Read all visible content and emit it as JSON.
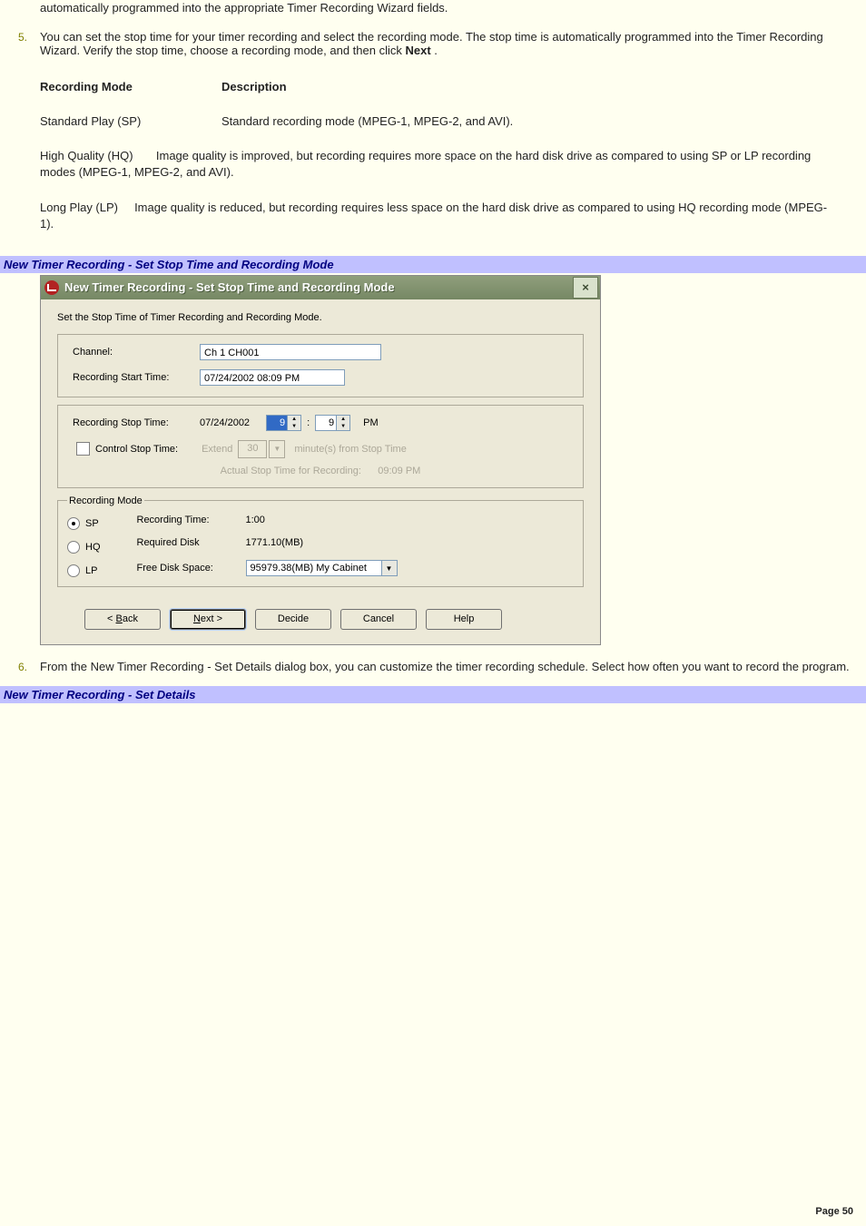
{
  "intro_line": "automatically programmed into the appropriate Timer Recording Wizard fields.",
  "step5": {
    "num": "5.",
    "text_a": "You can set the stop time for your timer recording and select the recording mode. The stop time is automatically programmed into the Timer Recording Wizard. Verify the stop time, choose a recording mode, and then click ",
    "bold": "Next",
    "text_b": " ."
  },
  "table": {
    "head_mode": "Recording Mode",
    "head_desc": "Description",
    "rows": [
      {
        "mode": "Standard Play (SP)",
        "desc": "Standard recording mode (MPEG-1, MPEG-2, and AVI)."
      },
      {
        "mode": "High Quality (HQ)",
        "desc": "Image quality is improved, but recording requires more space on the hard disk drive as compared to using SP or LP recording modes (MPEG-1, MPEG-2, and AVI)."
      },
      {
        "mode": "Long Play (LP)",
        "desc": "Image quality is reduced, but recording requires less space on the hard disk drive as compared to using HQ recording mode (MPEG-1)."
      }
    ]
  },
  "section1": "New Timer Recording - Set Stop Time and Recording Mode",
  "dialog": {
    "title": "New Timer Recording - Set Stop Time and Recording Mode",
    "close": "×",
    "lead": "Set the Stop Time of Timer Recording and Recording Mode.",
    "channel_label": "Channel:",
    "channel_value": "Ch 1 CH001",
    "start_label": "Recording Start Time:",
    "start_value": "07/24/2002 08:09 PM",
    "stop_label": "Recording Stop Time:",
    "stop_date": "07/24/2002",
    "stop_h": "9",
    "stop_m": "9",
    "pm": "PM",
    "ctrl_label": "Control Stop Time:",
    "extend_label": "Extend",
    "extend_val": "30",
    "extend_suffix": "minute(s) from Stop Time",
    "actual_label": "Actual Stop Time for Recording:",
    "actual_val": "09:09 PM",
    "recmode_legend": "Recording Mode",
    "radios": {
      "sp": "SP",
      "hq": "HQ",
      "lp": "LP"
    },
    "info": {
      "rec_time_l": "Recording Time:",
      "rec_time_v": "1:00",
      "req_disk_l": "Required Disk",
      "req_disk_v": "1771.10(MB)",
      "free_l": "Free Disk Space:",
      "free_v": "95979.38(MB) My Cabinet"
    },
    "buttons": {
      "back": "< Back",
      "next": "Next >",
      "decide": "Decide",
      "cancel": "Cancel",
      "help": "Help"
    }
  },
  "step6": {
    "num": "6.",
    "text": "From the New Timer Recording - Set Details dialog box, you can customize the timer recording schedule. Select how often you want to record the program."
  },
  "section2": "New Timer Recording - Set Details",
  "page_num": "Page 50"
}
